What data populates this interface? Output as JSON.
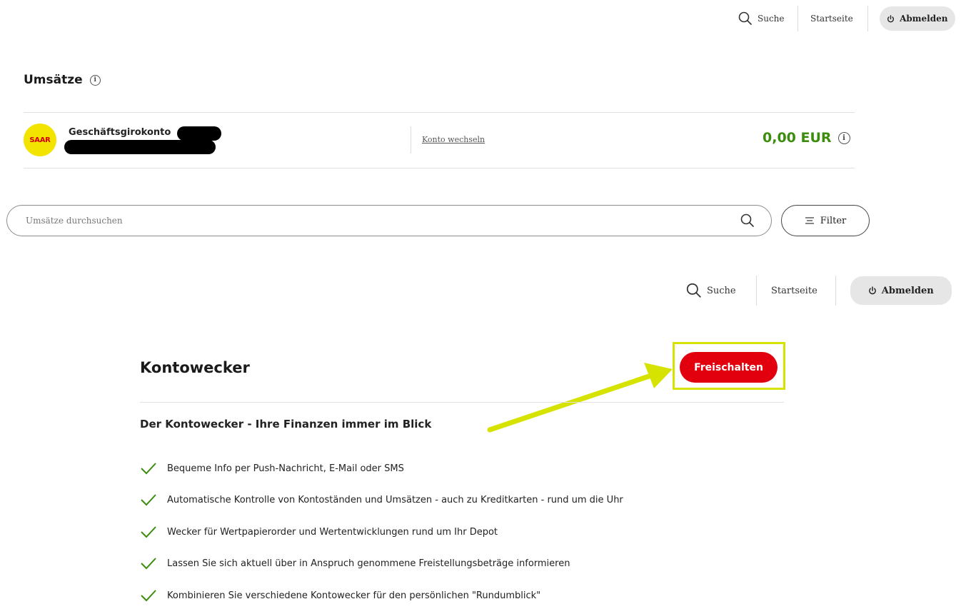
{
  "top_nav": {
    "search_label": "Suche",
    "home_label": "Startseite",
    "logout_label": "Abmelden"
  },
  "page": {
    "title": "Umsätze"
  },
  "account": {
    "bank_logo_text": "SAAR",
    "name": "Geschäftsgirokonto",
    "switch_label": "Konto wechseln",
    "balance": "0,00 EUR"
  },
  "search": {
    "placeholder": "Umsätze durchsuchen",
    "value": ""
  },
  "filter": {
    "label": "Filter"
  },
  "kontowecker": {
    "title": "Kontowecker",
    "unlock_label": "Freischalten",
    "subtitle": "Der Kontowecker - Ihre Finanzen immer im Blick",
    "features": [
      "Bequeme Info per Push-Nachricht, E-Mail oder SMS",
      "Automatische Kontrolle von Kontoständen und Umsätzen - auch zu Kreditkarten - rund um die Uhr",
      "Wecker für Wertpapierorder und Wertentwicklungen rund um Ihr Depot",
      "Lassen Sie sich aktuell über in Anspruch genommene Freistellungsbeträge informieren",
      "Kombinieren Sie verschiedene Kontowecker für den persönlichen \"Rundumblick\""
    ]
  },
  "colors": {
    "accent_red": "#e2000f",
    "balance_green": "#3c8c0e",
    "highlight_yellow": "#d6e300",
    "check_green": "#3c8c0e",
    "logo_yellow": "#f3e400"
  },
  "icons": [
    "search-icon",
    "power-icon",
    "info-icon",
    "filter-icon",
    "check-icon",
    "arrow-annotation"
  ]
}
